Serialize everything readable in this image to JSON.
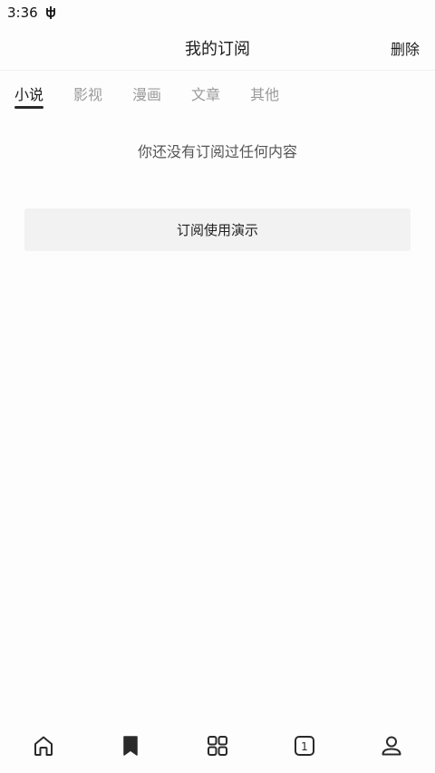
{
  "status_bar": {
    "time": "3:36",
    "icons": [
      "debug-app-icon"
    ]
  },
  "header": {
    "title": "我的订阅",
    "delete_label": "删除"
  },
  "tabs": [
    {
      "label": "小说",
      "active": true
    },
    {
      "label": "影视",
      "active": false
    },
    {
      "label": "漫画",
      "active": false
    },
    {
      "label": "文章",
      "active": false
    },
    {
      "label": "其他",
      "active": false
    }
  ],
  "main": {
    "empty_message": "你还没有订阅过任何内容",
    "demo_button_label": "订阅使用演示"
  },
  "bottom_nav": {
    "items": [
      {
        "icon": "home-icon",
        "active": false
      },
      {
        "icon": "bookmark-icon",
        "active": true
      },
      {
        "icon": "grid-icon",
        "active": false
      },
      {
        "icon": "tab-count-icon",
        "active": false,
        "badge": "1"
      },
      {
        "icon": "profile-icon",
        "active": false
      }
    ]
  },
  "colors": {
    "text_primary": "#1c1c1c",
    "text_inactive": "#9a9a9a",
    "button_bg": "#f2f2f2",
    "background": "#fdfdfd"
  }
}
